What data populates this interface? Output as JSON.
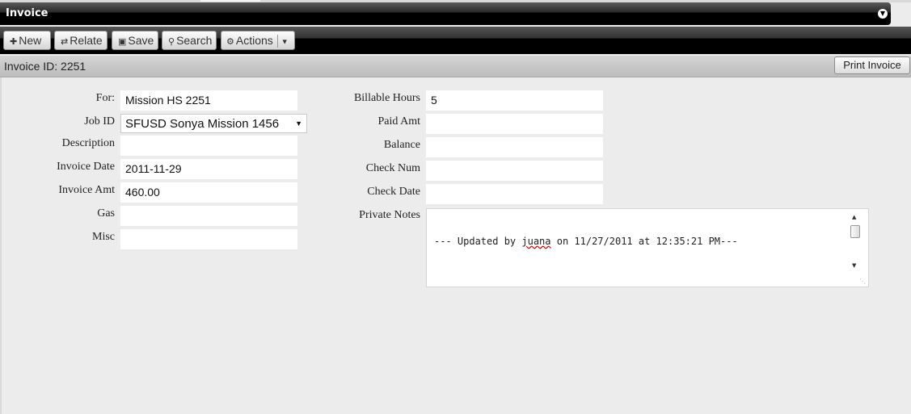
{
  "window": {
    "title": "Invoice"
  },
  "toolbar": {
    "new_label": "New",
    "relate_label": "Relate",
    "save_label": "Save",
    "search_label": "Search",
    "actions_label": "Actions"
  },
  "header": {
    "invoice_id_text": "Invoice ID: 2251",
    "print_label": "Print Invoice"
  },
  "left_fields": {
    "for_label": "For:",
    "for_value": "Mission HS 2251",
    "job_label": "Job ID",
    "job_value": "SFUSD Sonya Mission 1456",
    "desc_label": "Description",
    "desc_value": "",
    "inv_date_label": "Invoice Date",
    "inv_date_value": "2011-11-29",
    "inv_amt_label": "Invoice Amt",
    "inv_amt_value": "460.00",
    "gas_label": "Gas",
    "gas_value": "",
    "misc_label": "Misc",
    "misc_value": ""
  },
  "right_fields": {
    "hours_label": "Billable Hours",
    "hours_value": "5",
    "paid_label": "Paid Amt",
    "paid_value": "",
    "balance_label": "Balance",
    "balance_value": "",
    "check_num_label": "Check Num",
    "check_num_value": "",
    "check_date_label": "Check Date",
    "check_date_value": "",
    "notes_label": "Private Notes",
    "notes_prefix": "--- Updated by ",
    "notes_user": "juana",
    "notes_suffix": " on 11/27/2011 at 12:35:21 PM---"
  },
  "icons": {
    "new": "plus-icon",
    "relate": "arrows-icon",
    "save": "floppy-icon",
    "search": "magnifier-icon",
    "actions": "gear-icon",
    "collapse": "chevron-down-icon"
  }
}
